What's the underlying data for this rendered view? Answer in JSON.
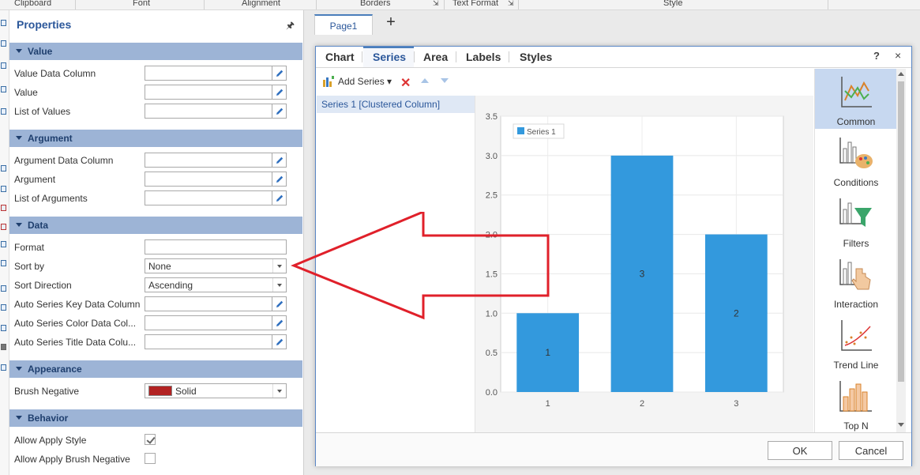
{
  "ribbon": {
    "groups": [
      "Clipboard",
      "Font",
      "Alignment",
      "Borders",
      "Text Format",
      "Style"
    ]
  },
  "properties": {
    "title": "Properties",
    "sections": {
      "value": {
        "title": "Value",
        "rows": [
          {
            "label": "Value Data Column",
            "value": ""
          },
          {
            "label": "Value",
            "value": ""
          },
          {
            "label": "List of Values",
            "value": ""
          }
        ]
      },
      "argument": {
        "title": "Argument",
        "rows": [
          {
            "label": "Argument Data Column",
            "value": ""
          },
          {
            "label": "Argument",
            "value": ""
          },
          {
            "label": "List of Arguments",
            "value": ""
          }
        ]
      },
      "data": {
        "title": "Data",
        "rows": [
          {
            "label": "Format",
            "value": ""
          },
          {
            "label": "Sort by",
            "value": "None"
          },
          {
            "label": "Sort Direction",
            "value": "Ascending"
          },
          {
            "label": "Auto Series Key Data Column",
            "value": ""
          },
          {
            "label": "Auto Series Color Data Col...",
            "value": ""
          },
          {
            "label": "Auto Series Title Data Colu...",
            "value": ""
          }
        ]
      },
      "appearance": {
        "title": "Appearance",
        "rows": [
          {
            "label": "Brush Negative",
            "value": "Solid",
            "color": "#b22222"
          }
        ]
      },
      "behavior": {
        "title": "Behavior",
        "rows": [
          {
            "label": "Allow Apply Style",
            "checked": true
          },
          {
            "label": "Allow Apply Brush Negative",
            "checked": false
          }
        ]
      }
    }
  },
  "designer": {
    "page_tab": "Page1",
    "add_page": "+"
  },
  "dialog": {
    "tabs": [
      "Chart",
      "Series",
      "Area",
      "Labels",
      "Styles"
    ],
    "active_tab": "Series",
    "help": "?",
    "close": "×",
    "toolbar": {
      "add_series": "Add Series"
    },
    "series_list": [
      "Series 1 [Clustered Column]"
    ],
    "gallery": [
      "Common",
      "Conditions",
      "Filters",
      "Interaction",
      "Trend Line",
      "Top N"
    ],
    "buttons": {
      "ok": "OK",
      "cancel": "Cancel"
    }
  },
  "chart_data": {
    "type": "bar",
    "categories": [
      "1",
      "2",
      "3"
    ],
    "series": [
      {
        "name": "Series 1",
        "values": [
          1,
          3,
          2
        ],
        "color": "#3399dd"
      }
    ],
    "data_labels": [
      "1",
      "3",
      "2"
    ],
    "ylim": [
      0,
      3.5
    ],
    "yticks": [
      "0.0",
      "0.5",
      "1.0",
      "1.5",
      "2.0",
      "2.5",
      "3.0",
      "3.5"
    ],
    "grid": true,
    "legend": "top-left"
  },
  "colors": {
    "accent": "#2b579a",
    "section_header": "#9db4d6",
    "annotation_arrow": "#e0202a"
  }
}
